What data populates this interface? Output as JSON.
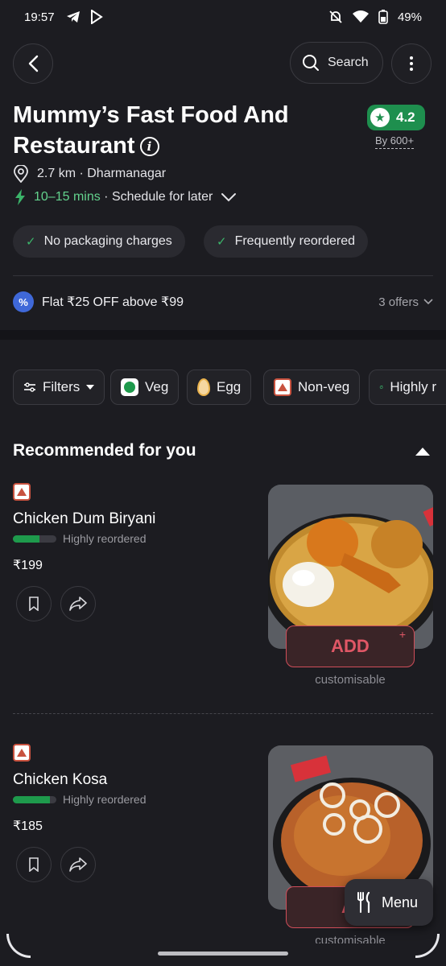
{
  "status_bar": {
    "time": "19:57",
    "battery": "49%"
  },
  "header": {
    "search_label": "Search"
  },
  "restaurant": {
    "name": "Mummy’s Fast Food And Restaurant",
    "rating": "4.2",
    "rating_count": "By 600+",
    "distance_location": "2.7 km · Dharmanagar",
    "delivery_time": "10–15 mins",
    "schedule": "· Schedule for later"
  },
  "chips": [
    {
      "label": "No packaging charges"
    },
    {
      "label": "Frequently reordered"
    }
  ],
  "offer": {
    "text": "Flat ₹25 OFF above ₹99",
    "count": "3 offers"
  },
  "filters": [
    {
      "label": "Filters"
    },
    {
      "label": "Veg"
    },
    {
      "label": "Egg"
    },
    {
      "label": "Non-veg"
    },
    {
      "label": "Highly r"
    }
  ],
  "section": {
    "title": "Recommended for you"
  },
  "items": [
    {
      "name": "Chicken Dum Biryani",
      "reorder_label": "Highly reordered",
      "reorder_level": 0.62,
      "price": "₹199",
      "add_label": "ADD",
      "customisable": "customisable"
    },
    {
      "name": "Chicken Kosa",
      "reorder_label": "Highly reordered",
      "reorder_level": 0.85,
      "price": "₹185",
      "add_label": "AI",
      "customisable": "customisable"
    }
  ],
  "menu_fab": {
    "label": "Menu"
  },
  "colors": {
    "background": "#1c1c21",
    "rating_green": "#1e8f4e",
    "add_red": "#e05766",
    "time_green": "#63d28d"
  }
}
